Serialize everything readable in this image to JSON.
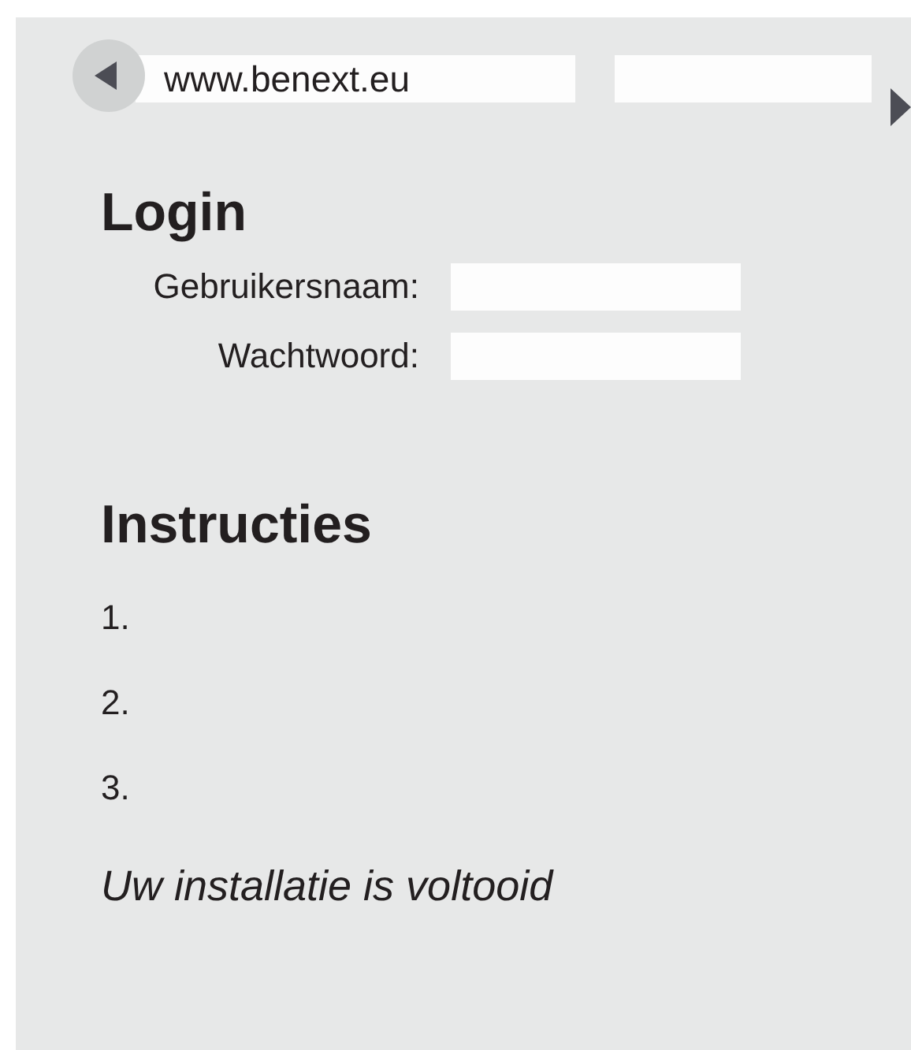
{
  "address_bar": {
    "url": "www.benext.eu"
  },
  "login": {
    "title": "Login",
    "fields": [
      {
        "label": "Gebruikersnaam:"
      },
      {
        "label": "Wachtwoord:"
      }
    ]
  },
  "instructions": {
    "title": "Instructies",
    "steps": [
      "1.",
      "2.",
      "3."
    ]
  },
  "status": "Uw installatie is voltooid"
}
